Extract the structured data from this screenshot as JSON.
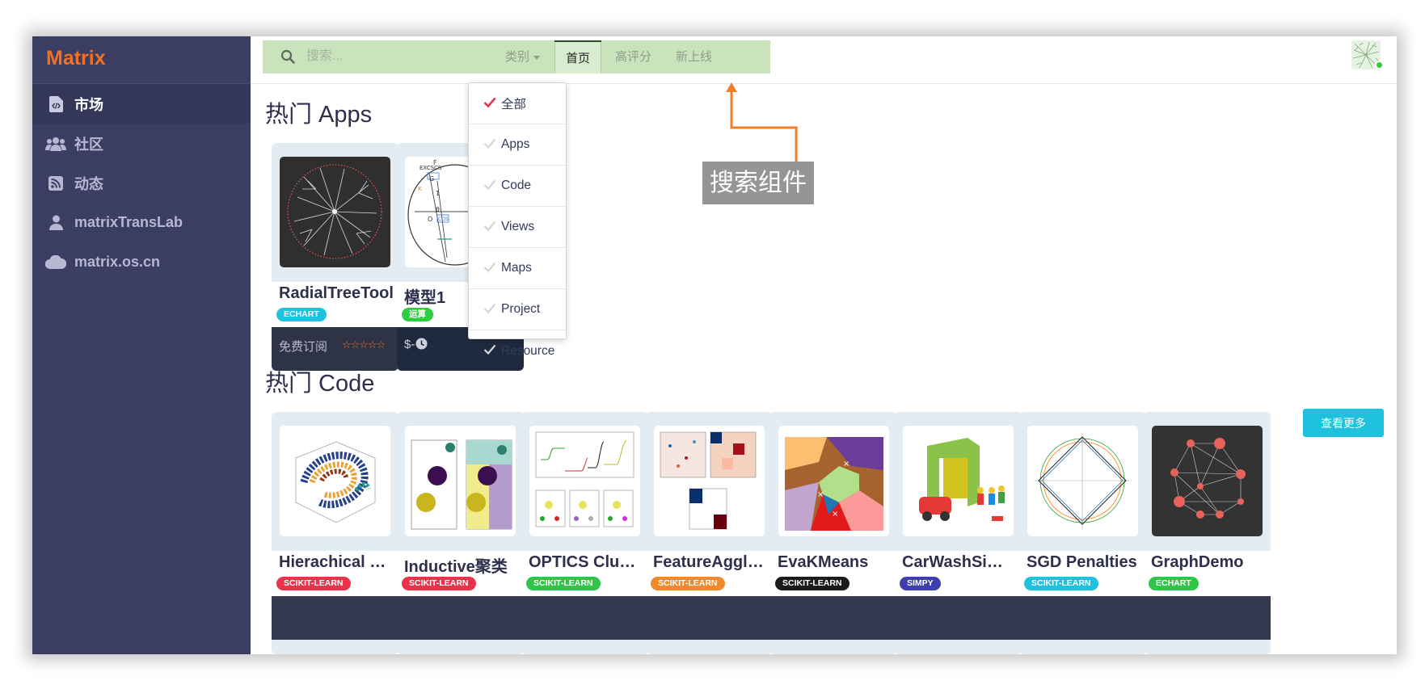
{
  "sidebar": {
    "brand": "Matrix",
    "items": [
      {
        "label": "市场",
        "icon": "code-file-icon",
        "active": true
      },
      {
        "label": "社区",
        "icon": "users-icon",
        "active": false
      },
      {
        "label": "动态",
        "icon": "rss-icon",
        "active": false
      },
      {
        "label": "matrixTransLab",
        "icon": "user-icon",
        "active": false
      },
      {
        "label": "matrix.os.cn",
        "icon": "cloud-icon",
        "active": false
      }
    ]
  },
  "topbar": {
    "search": {
      "placeholder": "搜索...",
      "value": ""
    },
    "category_label": "类别",
    "tabs": [
      {
        "label": "首页",
        "active": true
      },
      {
        "label": "高评分",
        "active": false
      },
      {
        "label": "新上线",
        "active": false
      }
    ]
  },
  "dropdown": {
    "items": [
      {
        "label": "全部",
        "checked": true
      },
      {
        "label": "Apps",
        "checked": false
      },
      {
        "label": "Code",
        "checked": false
      },
      {
        "label": "Views",
        "checked": false
      },
      {
        "label": "Maps",
        "checked": false
      },
      {
        "label": "Project",
        "checked": false
      },
      {
        "label": "Resource",
        "checked": false
      }
    ]
  },
  "annotation": {
    "label": "搜索组件",
    "color": "#f07f2a"
  },
  "hot_apps": {
    "title": "热门 Apps",
    "cards": [
      {
        "name": "RadialTreeTool",
        "tag": "ECHART",
        "tag_color": "#1fc1dc",
        "price": "免费订阅",
        "stars": "☆☆☆☆☆"
      },
      {
        "name": "模型1",
        "tag": "运算",
        "tag_color": "#2ecc40",
        "price": "$-"
      }
    ]
  },
  "hot_code": {
    "title": "热门 Code",
    "more_label": "查看更多",
    "cards": [
      {
        "name": "Hierachical Cl...",
        "tag": "SCIKIT-LEARN",
        "tag_color": "#e9324c"
      },
      {
        "name": "Inductive聚类",
        "tag": "SCIKIT-LEARN",
        "tag_color": "#e9324c"
      },
      {
        "name": "OPTICS Clust...",
        "tag": "SCIKIT-LEARN",
        "tag_color": "#2ec549"
      },
      {
        "name": "FeatureAgglo...",
        "tag": "SCIKIT-LEARN",
        "tag_color": "#f08a2c"
      },
      {
        "name": "EvaKMeans",
        "tag": "SCIKIT-LEARN",
        "tag_color": "#1b1b1b"
      },
      {
        "name": "CarWashSimpy",
        "tag": "SIMPY",
        "tag_color": "#3e3fae"
      },
      {
        "name": "SGD Penalties",
        "tag": "SCIKIT-LEARN",
        "tag_color": "#1fc1dc"
      },
      {
        "name": "GraphDemo",
        "tag": "ECHART",
        "tag_color": "#2ec549"
      }
    ]
  }
}
